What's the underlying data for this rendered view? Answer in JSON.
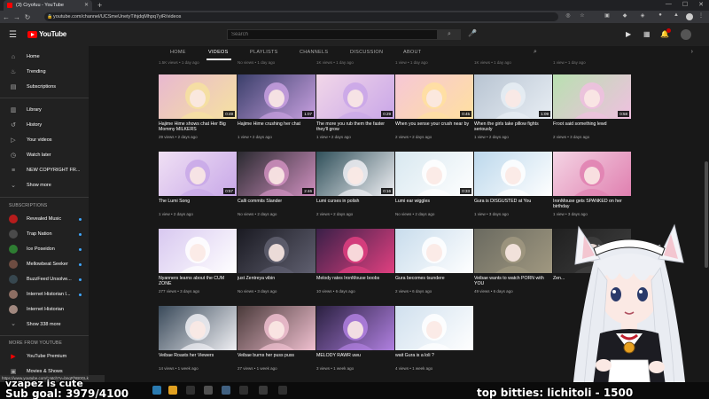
{
  "browser": {
    "tab_title": "(3) Cryofuu - YouTube",
    "tab_close": "✕",
    "new_tab": "+",
    "url": "youtube.com/channel/UCSmeUnetyTihjdqMhpq7yiR/videos"
  },
  "masthead": {
    "logo_text": "YouTube",
    "search_placeholder": "Search",
    "notif_count": "3"
  },
  "sidebar": {
    "primary": [
      {
        "label": "Home",
        "icon": "home-icon"
      },
      {
        "label": "Trending",
        "icon": "trending-icon"
      },
      {
        "label": "Subscriptions",
        "icon": "subscriptions-icon"
      }
    ],
    "library": [
      {
        "label": "Library",
        "icon": "library-icon"
      },
      {
        "label": "History",
        "icon": "history-icon"
      },
      {
        "label": "Your videos",
        "icon": "your-videos-icon"
      },
      {
        "label": "Watch later",
        "icon": "watch-later-icon"
      },
      {
        "label": "NEW COPYRIGHT FR...",
        "icon": "playlist-icon"
      },
      {
        "label": "Show more",
        "icon": "chevron-down-icon"
      }
    ],
    "subs_heading": "SUBSCRIPTIONS",
    "subscriptions": [
      {
        "label": "Revealed Music",
        "color": "#b71c1c"
      },
      {
        "label": "Trap Nation",
        "color": "#4a4a4a"
      },
      {
        "label": "Ice Poseidon",
        "color": "#2e7d32"
      },
      {
        "label": "Mellowbeat Seeker",
        "color": "#6d4c41"
      },
      {
        "label": "BuzzFeed Unsolve...",
        "color": "#37474f"
      },
      {
        "label": "Internet Historian I...",
        "color": "#8d6e63"
      },
      {
        "label": "Internet Historian",
        "color": "#a1887f"
      },
      {
        "label": "Show 338 more",
        "color": "#212121"
      }
    ],
    "more_heading": "MORE FROM YOUTUBE",
    "more": [
      {
        "label": "YouTube Premium"
      },
      {
        "label": "Movies & Shows"
      }
    ]
  },
  "channel_tabs": [
    "HOME",
    "VIDEOS",
    "PLAYLISTS",
    "CHANNELS",
    "DISCUSSION",
    "ABOUT"
  ],
  "prev_row_meta": [
    "1.5K views • 1 day ago",
    "No views • 1 day ago",
    "1K views • 1 day ago",
    "1 view • 1 day ago",
    "1K views • 1 day ago",
    "1 view • 1 day ago"
  ],
  "videos": [
    {
      "title": "Hajime Hime shows chat Her Big Mommy MILKERS",
      "meta": "29 views • 2 days ago",
      "duration": "0:49",
      "bg": "#e8b8d0",
      "accent": "#f6e2a0"
    },
    {
      "title": "Hajime Hime crushing her chat",
      "meta": "1 view • 2 days ago",
      "duration": "1:07",
      "bg": "#3a3f6a",
      "accent": "#c8a0e0"
    },
    {
      "title": "The more you rub them the faster they'll grow",
      "meta": "1 view • 2 days ago",
      "duration": "0:29",
      "bg": "#f2d7e8",
      "accent": "#c9a6e8"
    },
    {
      "title": "When you sense your crush near by",
      "meta": "2 views • 2 days ago",
      "duration": "0:45",
      "bg": "#f6c7d6",
      "accent": "#ffe0a0"
    },
    {
      "title": "When the girls take pillow fights seriously",
      "meta": "1 view • 2 days ago",
      "duration": "1:09",
      "bg": "#b8c4d2",
      "accent": "#e8eef4"
    },
    {
      "title": "Froot said something lewd",
      "meta": "2 views • 3 days ago",
      "duration": "0:58",
      "bg": "#b8e0b0",
      "accent": "#f0c0e0"
    },
    {
      "title": "The Lumi Song",
      "meta": "1 view • 2 days ago",
      "duration": "0:57",
      "bg": "#f0e0f4",
      "accent": "#c8a8e8"
    },
    {
      "title": "Calli commits Slander",
      "meta": "No views • 2 days ago",
      "duration": "2:46",
      "bg": "#2a2a30",
      "accent": "#d090c0"
    },
    {
      "title": "Lumi curses in polish",
      "meta": "2 views • 2 days ago",
      "duration": "0:16",
      "bg": "#30505a",
      "accent": "#f0f0f4"
    },
    {
      "title": "Lumi ear wiggles",
      "meta": "No views • 2 days ago",
      "duration": "0:33",
      "bg": "#d8e8f0",
      "accent": "#ffffff"
    },
    {
      "title": "Gura is DISGUSTED at You",
      "meta": "1 view • 3 days ago",
      "duration": "",
      "bg": "#bcd8ec",
      "accent": "#ffffff"
    },
    {
      "title": "IronMouse gets SPANKED on her birthday",
      "meta": "1 view • 3 days ago",
      "duration": "",
      "bg": "#f4d4e4",
      "accent": "#e080b0"
    },
    {
      "title": "Nyanners learns about the CUM ZONE",
      "meta": "277 views • 3 days ago",
      "duration": "",
      "bg": "#d8c8f0",
      "accent": "#ffffff"
    },
    {
      "title": "just Zentreya vibin",
      "meta": "No views • 3 days ago",
      "duration": "",
      "bg": "#1a1a22",
      "accent": "#606070"
    },
    {
      "title": "Melody rates IronMouse boobs",
      "meta": "10 views • 6 days ago",
      "duration": "",
      "bg": "#3a2048",
      "accent": "#e04080"
    },
    {
      "title": "Gura becomes tsundere",
      "meta": "2 views • 6 days ago",
      "duration": "",
      "bg": "#c8dcec",
      "accent": "#ffffff"
    },
    {
      "title": "Veibae wants to watch PORN with YOU",
      "meta": "49 views • 6 days ago",
      "duration": "",
      "bg": "#6a6a60",
      "accent": "#a09880"
    },
    {
      "title": "Zen...",
      "meta": "",
      "duration": "",
      "bg": "#202020",
      "accent": "#404040"
    },
    {
      "title": "Veibae Roasts her Viewers",
      "meta": "14 views • 1 week ago",
      "duration": "",
      "bg": "#3a4a5a",
      "accent": "#f0f0f4"
    },
    {
      "title": "Veibae burns her puss puss",
      "meta": "27 views • 1 week ago",
      "duration": "",
      "bg": "#4a3a3a",
      "accent": "#f0c0d0"
    },
    {
      "title": "MELODY RAWR uwu",
      "meta": "3 views • 1 week ago",
      "duration": "",
      "bg": "#2a2040",
      "accent": "#b080e0"
    },
    {
      "title": "wait Gura is a loli ?",
      "meta": "4 views • 1 week ago",
      "duration": "",
      "bg": "#d0e0ee",
      "accent": "#ffffff"
    }
  ],
  "status_link": "https://www.youtube.com/watch?v=bnq5f6B0GLk",
  "overlay": {
    "chat_line": "vzapez is cute",
    "sub_goal": "Sub goal: 3979/4100",
    "top_bitties": "top bitties: lichitoli - 1500"
  }
}
